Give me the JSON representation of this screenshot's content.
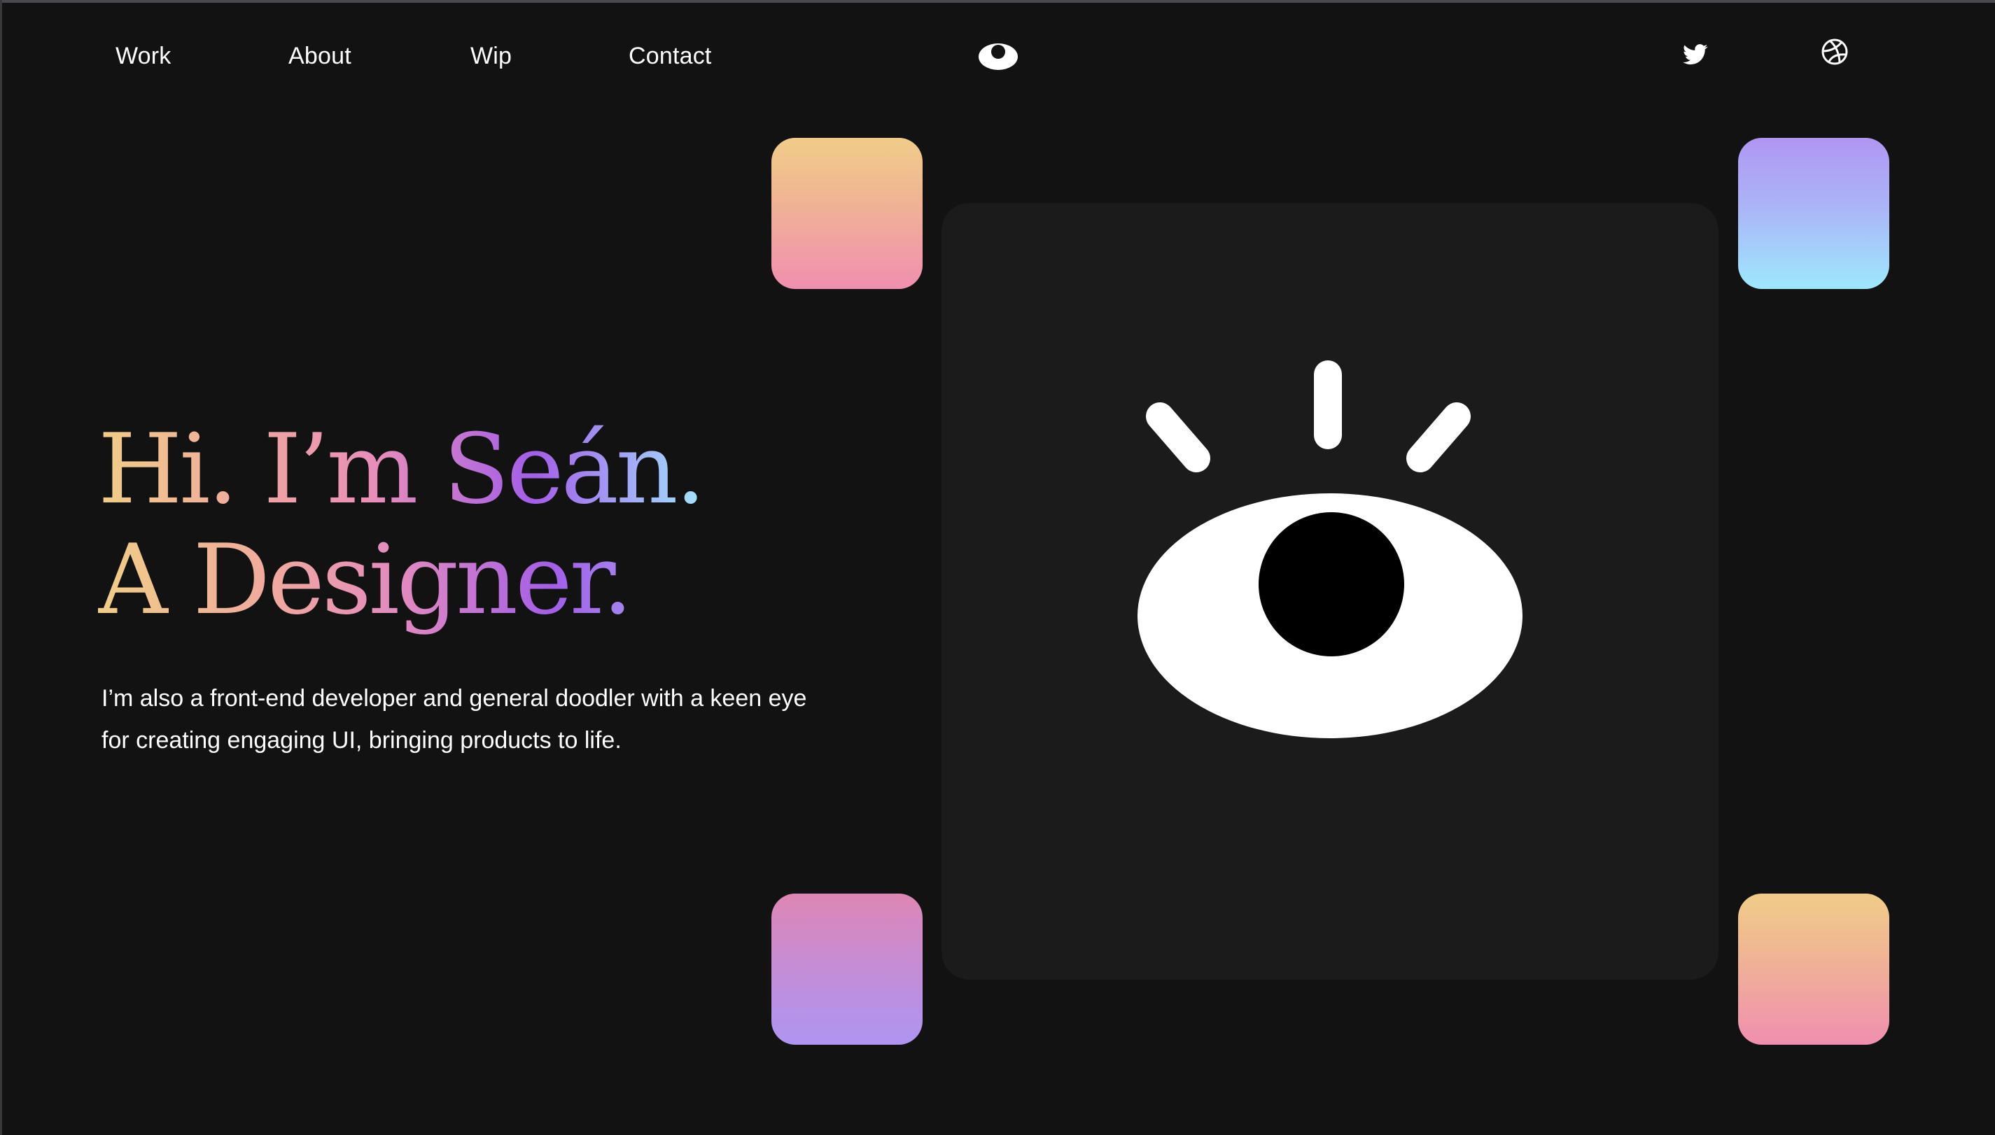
{
  "nav": {
    "links": [
      {
        "label": "Work"
      },
      {
        "label": "About"
      },
      {
        "label": "Wip"
      },
      {
        "label": "Contact"
      }
    ],
    "logo_icon": "eye-icon",
    "social": [
      {
        "name": "Twitter",
        "icon": "twitter-bird-icon"
      },
      {
        "name": "Dribbble",
        "icon": "dribbble-ball-icon"
      }
    ]
  },
  "hero": {
    "title_line_1": "Hi. I’m Seán.",
    "title_line_2": "A Designer.",
    "subtitle_line_1": "I’m also a front-end developer and general doodler with a keen eye",
    "subtitle_line_2": "for creating engaging UI, bringing products to life."
  },
  "art": {
    "illustration": "eye-illustration",
    "tiles": [
      {
        "position": "top-left",
        "colors": [
          "#f0cc88",
          "#f08fb0"
        ]
      },
      {
        "position": "top-right",
        "colors": [
          "#b096f2",
          "#9ee8fd"
        ]
      },
      {
        "position": "bottom-left",
        "colors": [
          "#de86b4",
          "#ae95f2"
        ]
      },
      {
        "position": "bottom-right",
        "colors": [
          "#f0cc88",
          "#f08fb0"
        ]
      }
    ]
  },
  "colors": {
    "background": "#121212",
    "card": "#1b1b1b",
    "text": "#ffffff",
    "gradient_yellow": "#f0ce86",
    "gradient_pink": "#e98fb9",
    "gradient_purple": "#a35ee8",
    "gradient_blue": "#a3e6fd"
  }
}
